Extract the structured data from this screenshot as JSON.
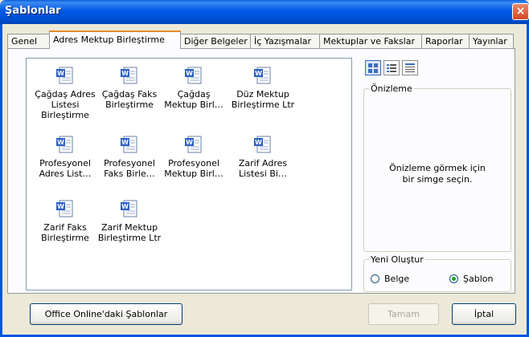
{
  "window": {
    "title": "Şablonlar",
    "close_symbol": "×"
  },
  "tabs": [
    {
      "label": "Genel"
    },
    {
      "label": "Adres Mektup Birleştirme"
    },
    {
      "label": "Diğer Belgeler"
    },
    {
      "label": "İç Yazışmalar"
    },
    {
      "label": "Mektuplar ve Fakslar"
    },
    {
      "label": "Raporlar"
    },
    {
      "label": "Yayınlar"
    }
  ],
  "active_tab": "Adres Mektup Birleştirme",
  "templates": [
    {
      "label": "Çağdaş Adres Listesi Birleştirme",
      "icon": "word-document-icon"
    },
    {
      "label": "Çağdaş Faks Birleştirme",
      "icon": "word-document-icon"
    },
    {
      "label": "Çağdaş Mektup Birl…",
      "icon": "word-document-icon"
    },
    {
      "label": "Düz Mektup Birleştirme Ltr",
      "icon": "word-document-icon"
    },
    {
      "label": "Profesyonel Adres List…",
      "icon": "word-document-icon"
    },
    {
      "label": "Profesyonel Faks Birle…",
      "icon": "word-document-icon"
    },
    {
      "label": "Profesyonel Mektup Birl…",
      "icon": "word-document-icon"
    },
    {
      "label": "Zarif Adres Listesi Bi…",
      "icon": "word-document-icon"
    },
    {
      "label": "Zarif Faks Birleştirme",
      "icon": "word-document-icon"
    },
    {
      "label": "Zarif Mektup Birleştirme Ltr",
      "icon": "word-document-icon"
    }
  ],
  "view_buttons": [
    {
      "icon": "large-icons-view-icon",
      "selected": true
    },
    {
      "icon": "list-view-icon",
      "selected": false
    },
    {
      "icon": "details-view-icon",
      "selected": false
    }
  ],
  "preview": {
    "label": "Önizleme",
    "message_line1": "Önizleme görmek için",
    "message_line2": "bir simge seçin."
  },
  "create_new": {
    "label": "Yeni Oluştur",
    "options": [
      {
        "label": "Belge",
        "checked": false
      },
      {
        "label": "Şablon",
        "checked": true
      }
    ]
  },
  "buttons": {
    "online": "Office Online'daki Şablonlar",
    "ok": "Tamam",
    "cancel": "İptal"
  },
  "colors": {
    "title_bar": "#0054e3",
    "close_button": "#d3461f",
    "tab_highlight": "#e68b2c"
  }
}
